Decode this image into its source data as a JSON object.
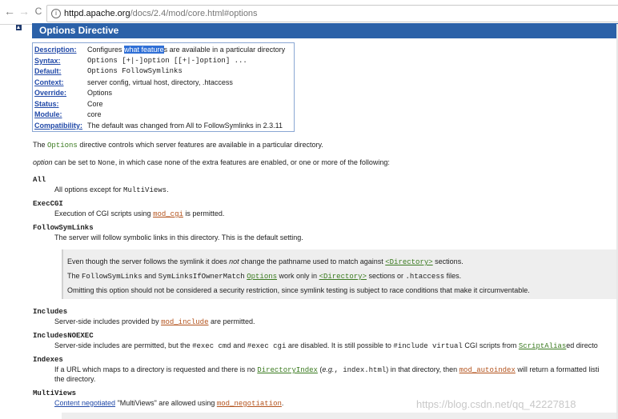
{
  "browser": {
    "back_glyph": "←",
    "forward_glyph": "→",
    "reload_glyph": "C",
    "info_glyph": "i",
    "url_host": "httpd.apache.org",
    "url_path": "/docs/2.4/mod/core.html#options"
  },
  "page": {
    "title": "Options Directive",
    "summary": {
      "description_label": "Description:",
      "description_pre": "Configures ",
      "description_highlight": "what feature",
      "description_post": "s are available in a particular directory",
      "syntax_label": "Syntax:",
      "syntax_value": "Options [+|-]option [[+|-]option] ...",
      "default_label": "Default:",
      "default_value": "Options FollowSymlinks",
      "context_label": "Context:",
      "context_value": "server config, virtual host, directory, .htaccess",
      "override_label": "Override:",
      "override_value": "Options",
      "status_label": "Status:",
      "status_value": "Core",
      "module_label": "Module:",
      "module_value": "core",
      "compat_label": "Compatibility:",
      "compat_value": "The default was changed from All to FollowSymlinks in 2.3.11"
    },
    "intro1": {
      "pre": "The ",
      "code": "Options",
      "post": " directive controls which server features are available in a particular directory."
    },
    "intro2": {
      "em": "option",
      "mid": " can be set to ",
      "code": "None",
      "post": ", in which case none of the extra features are enabled, or one or more of the following:"
    },
    "options": {
      "all_term": "All",
      "all_desc_pre": "All options except for ",
      "all_desc_code": "MultiViews",
      "all_desc_post": ".",
      "execcgi_term": "ExecCGI",
      "execcgi_desc_pre": "Execution of CGI scripts using ",
      "execcgi_desc_link": "mod_cgi",
      "execcgi_desc_post": " is permitted.",
      "follow_term": "FollowSymLinks",
      "follow_desc": "The server will follow symbolic links in this directory. This is the default setting.",
      "note_line1_pre": "Even though the server follows the symlink it does ",
      "note_line1_em": "not",
      "note_line1_mid": " change the pathname used to match against ",
      "note_line1_link": "<Directory>",
      "note_line1_post": " sections.",
      "note_line2_pre": "The ",
      "note_line2_code1": "FollowSymLinks",
      "note_line2_and": " and ",
      "note_line2_code2": "SymLinksIfOwnerMatch",
      "note_line2_sp": " ",
      "note_line2_link1": "Options",
      "note_line2_mid": " work only in ",
      "note_line2_link2": "<Directory>",
      "note_line2_or": " sections or ",
      "note_line2_code3": ".htaccess",
      "note_line2_post": " files.",
      "note_line3": "Omitting this option should not be considered a security restriction, since symlink testing is subject to race conditions that make it circumventable.",
      "includes_term": "Includes",
      "includes_desc_pre": "Server-side includes provided by ",
      "includes_desc_link": "mod_include",
      "includes_desc_post": " are permitted.",
      "inoexec_term": "IncludesNOEXEC",
      "inoexec_desc_pre": "Server-side includes are permitted, but the ",
      "inoexec_code1": "#exec cmd",
      "inoexec_and": " and ",
      "inoexec_code2": "#exec cgi",
      "inoexec_mid": " are disabled. It is still possible to ",
      "inoexec_code3": "#include virtual",
      "inoexec_mid2": " CGI scripts from ",
      "inoexec_link": "ScriptAlias",
      "inoexec_tail": "ed directo",
      "indexes_term": "Indexes",
      "indexes_desc_pre": "If a URL which maps to a directory is requested and there is no ",
      "indexes_link1": "DirectoryIndex",
      "indexes_mid": " (",
      "indexes_eg": "e.g.",
      "indexes_code": ", index.html",
      "indexes_mid2": ") in that directory, then ",
      "indexes_link2": "mod_autoindex",
      "indexes_tail": " will return a formatted listi",
      "indexes_line2": "the directory.",
      "multiviews_term": "MultiViews",
      "multiviews_link1": "Content negotiated",
      "multiviews_mid": " \"MultiViews\" are allowed using ",
      "multiviews_link2": "mod_negotiation",
      "multiviews_post": "."
    },
    "watermark": "https://blog.csdn.net/qq_42227818"
  }
}
